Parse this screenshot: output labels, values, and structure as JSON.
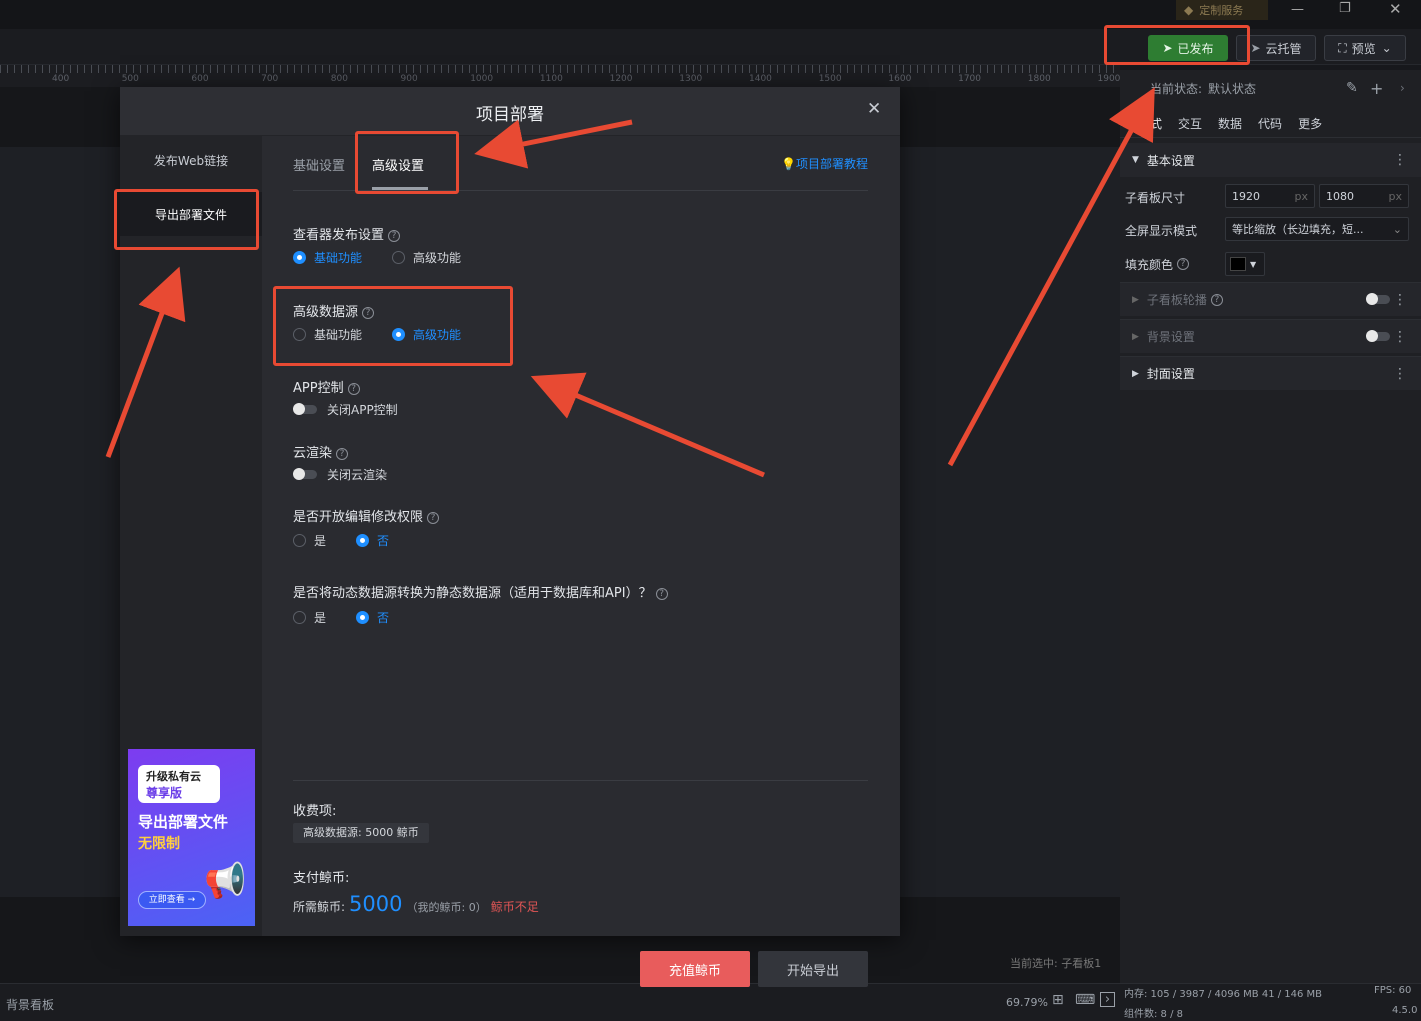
{
  "titlebar": {
    "service_label": "定制服务"
  },
  "toolbar": {
    "published_label": "已发布",
    "cloud_label": "云托管",
    "preview_label": "预览"
  },
  "ruler": {
    "ticks": [
      "400",
      "500",
      "600",
      "700",
      "800",
      "900",
      "1000",
      "1100",
      "1200",
      "1300",
      "1400",
      "1500",
      "1600",
      "1700",
      "1800",
      "1900"
    ]
  },
  "canvas": {
    "current_selected": "当前选中: 子看板1",
    "zoom": "69.79%",
    "bg_board": "背景看板"
  },
  "right_panel": {
    "state_label": "当前状态:",
    "state_value": "默认状态",
    "tabs": [
      "样式",
      "交互",
      "数据",
      "代码",
      "更多"
    ],
    "basic_settings": "基本设置",
    "size_label": "子看板尺寸",
    "width": "1920",
    "height": "1080",
    "unit": "px",
    "fullscreen_label": "全屏显示模式",
    "fullscreen_value": "等比缩放（长边填充，短...",
    "fill_color_label": "填充颜色",
    "carousel_label": "子看板轮播",
    "background_label": "背景设置",
    "cover_label": "封面设置"
  },
  "statusbar": {
    "memory": "内存: 105 / 3987 / 4096 MB  41 / 146 MB",
    "fps": "FPS: 60",
    "components": "组件数: 8 / 8",
    "version": "4.5.0"
  },
  "modal": {
    "title": "项目部署",
    "side_items": [
      "发布Web链接",
      "导出部署文件"
    ],
    "tabs": [
      "基础设置",
      "高级设置"
    ],
    "tutorial_link": "项目部署教程",
    "viewer_publish": {
      "label": "查看器发布设置",
      "options": [
        "基础功能",
        "高级功能"
      ],
      "selected": 0
    },
    "advanced_datasource": {
      "label": "高级数据源",
      "options": [
        "基础功能",
        "高级功能"
      ],
      "selected": 1
    },
    "app_control": {
      "label": "APP控制",
      "toggle_text": "关闭APP控制"
    },
    "cloud_render": {
      "label": "云渲染",
      "toggle_text": "关闭云渲染"
    },
    "edit_permission": {
      "label": "是否开放编辑修改权限",
      "options": [
        "是",
        "否"
      ],
      "selected": 1
    },
    "static_convert": {
      "label": "是否将动态数据源转换为静态数据源（适用于数据库和API）？",
      "options": [
        "是",
        "否"
      ],
      "selected": 1
    },
    "charge_label": "收费项:",
    "charge_item": "高级数据源: 5000 鲸币",
    "pay_label": "支付鲸币:",
    "required_label": "所需鲸币:",
    "required_amount": "5000",
    "my_coins": "（我的鲸币: 0）",
    "insufficient": "鲸币不足",
    "recharge_button": "充值鲸币",
    "export_button": "开始导出",
    "banner": {
      "line1": "升级私有云",
      "line2": "尊享版",
      "line3": "导出部署文件",
      "line4": "无限制",
      "cta": "立即查看 →"
    }
  },
  "colors": {
    "accent": "#1f8fff",
    "danger": "#e05555",
    "published": "#2e7d32",
    "annotation": "#e84a33"
  }
}
